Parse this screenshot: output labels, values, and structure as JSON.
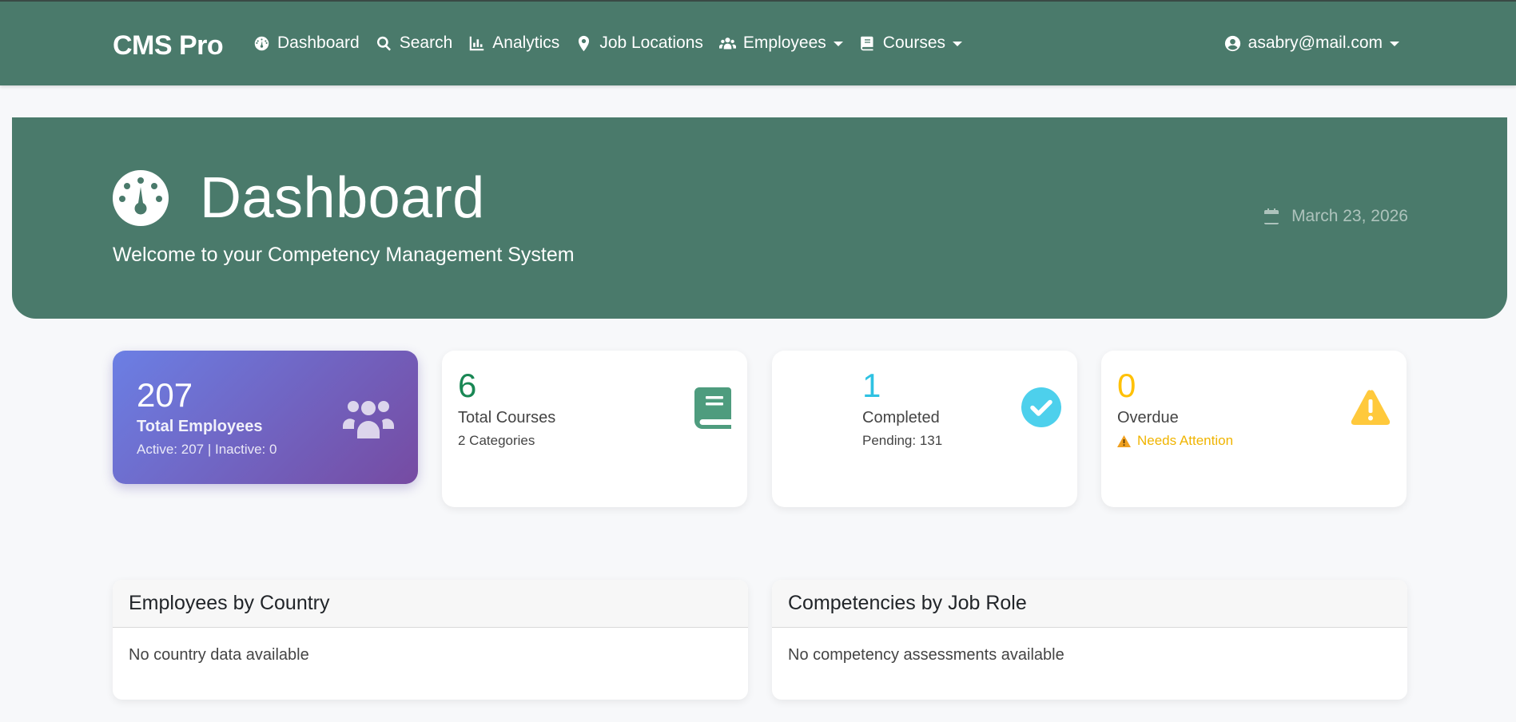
{
  "nav": {
    "brand": "CMS Pro",
    "items": [
      {
        "label": "Dashboard",
        "icon": "tachometer-icon"
      },
      {
        "label": "Search",
        "icon": "search-icon"
      },
      {
        "label": "Analytics",
        "icon": "chart-icon"
      },
      {
        "label": "Job Locations",
        "icon": "map-pin-icon"
      },
      {
        "label": "Employees",
        "icon": "users-icon",
        "dropdown": true
      },
      {
        "label": "Courses",
        "icon": "book-icon",
        "dropdown": true
      }
    ],
    "user": "asabry@mail.com"
  },
  "hero": {
    "title": "Dashboard",
    "subtitle": "Welcome to your Competency Management System",
    "date": "March 23, 2026"
  },
  "stats": {
    "employees": {
      "value": "207",
      "label": "Total Employees",
      "sub": "Active: 207 | Inactive: 0"
    },
    "courses": {
      "value": "6",
      "label": "Total Courses",
      "sub": "2 Categories"
    },
    "completed": {
      "value": "1",
      "label": "Completed",
      "sub": "Pending: 131"
    },
    "overdue": {
      "value": "0",
      "label": "Overdue",
      "sub": "Needs Attention"
    }
  },
  "panels": {
    "country": {
      "title": "Employees by Country",
      "empty": "No country data available"
    },
    "competencies": {
      "title": "Competencies by Job Role",
      "empty": "No competency assessments available"
    }
  },
  "colors": {
    "primary": "#4a7a6b",
    "success": "#198754",
    "info": "#2fc2e2",
    "warning": "#ffc107",
    "gradient_start": "#6b7fe4",
    "gradient_end": "#764ba2"
  }
}
